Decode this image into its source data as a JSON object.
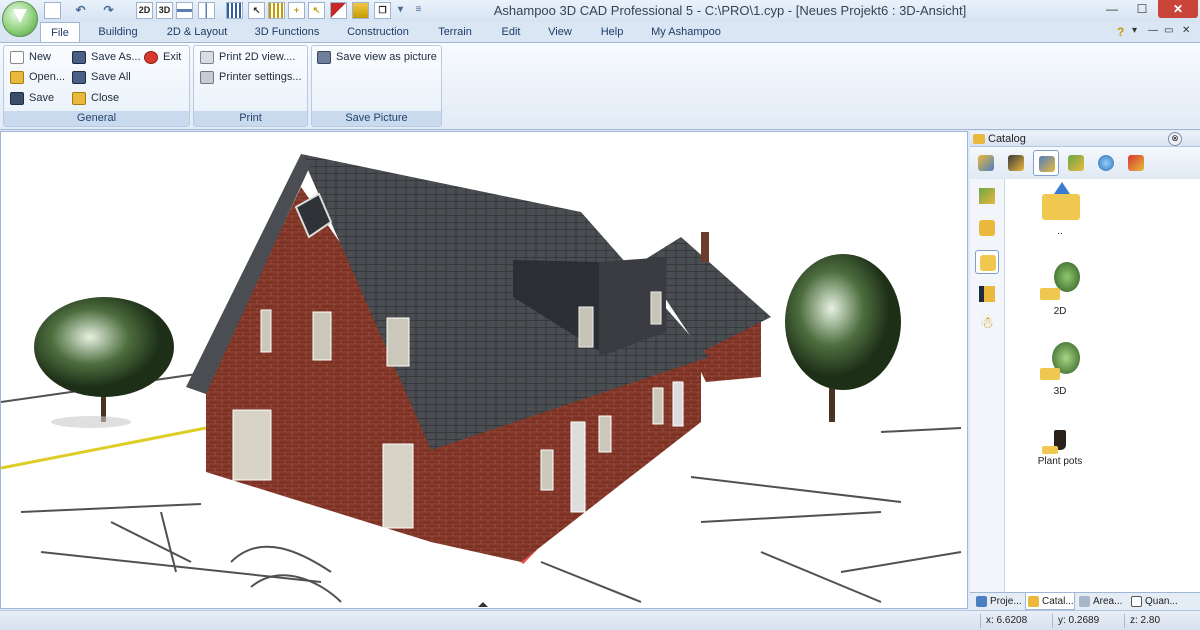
{
  "window": {
    "title": "Ashampoo 3D CAD Professional 5 - C:\\PRO\\1.cyp - [Neues Projekt6 : 3D-Ansicht]",
    "minimize": "—",
    "maximize": "☐",
    "close": "✕"
  },
  "quick_access": {
    "view_2d": "2D",
    "view_3d": "3D",
    "more": "▾"
  },
  "tabs": [
    "File",
    "Building",
    "2D & Layout",
    "3D Functions",
    "Construction",
    "Terrain",
    "Edit",
    "View",
    "Help",
    "My Ashampoo"
  ],
  "active_tab": "File",
  "help_icon": "?",
  "mdi": {
    "restore": "▭",
    "close": "✕",
    "down": "▾"
  },
  "ribbon": {
    "general": {
      "label": "General",
      "new": "New",
      "open": "Open...",
      "save": "Save",
      "save_as": "Save As...",
      "save_all": "Save All",
      "close": "Close",
      "exit": "Exit"
    },
    "print": {
      "label": "Print",
      "print_2d": "Print 2D view....",
      "printer_settings": "Printer settings..."
    },
    "save_picture": {
      "label": "Save Picture",
      "save_view": "Save view as picture"
    }
  },
  "catalog": {
    "title": "Catalog",
    "items": [
      {
        "label": "..",
        "icon": "folder-up-icon"
      },
      {
        "label": "2D",
        "icon": "plant-2d-icon"
      },
      {
        "label": "3D",
        "icon": "plant-3d-icon"
      },
      {
        "label": "Plant pots",
        "icon": "plant-pot-icon"
      }
    ]
  },
  "panel_tabs": [
    "Proje...",
    "Catal...",
    "Area...",
    "Quan..."
  ],
  "active_panel_tab": "Catal...",
  "status": {
    "x": "x: 6.6208",
    "y": "y: 0.2689",
    "z": "z: 2.80"
  },
  "colors": {
    "accent": "#1d3c66",
    "brick": "#7e3224",
    "roof": "#4a4d52",
    "ribbon_group": "#c9daee"
  }
}
